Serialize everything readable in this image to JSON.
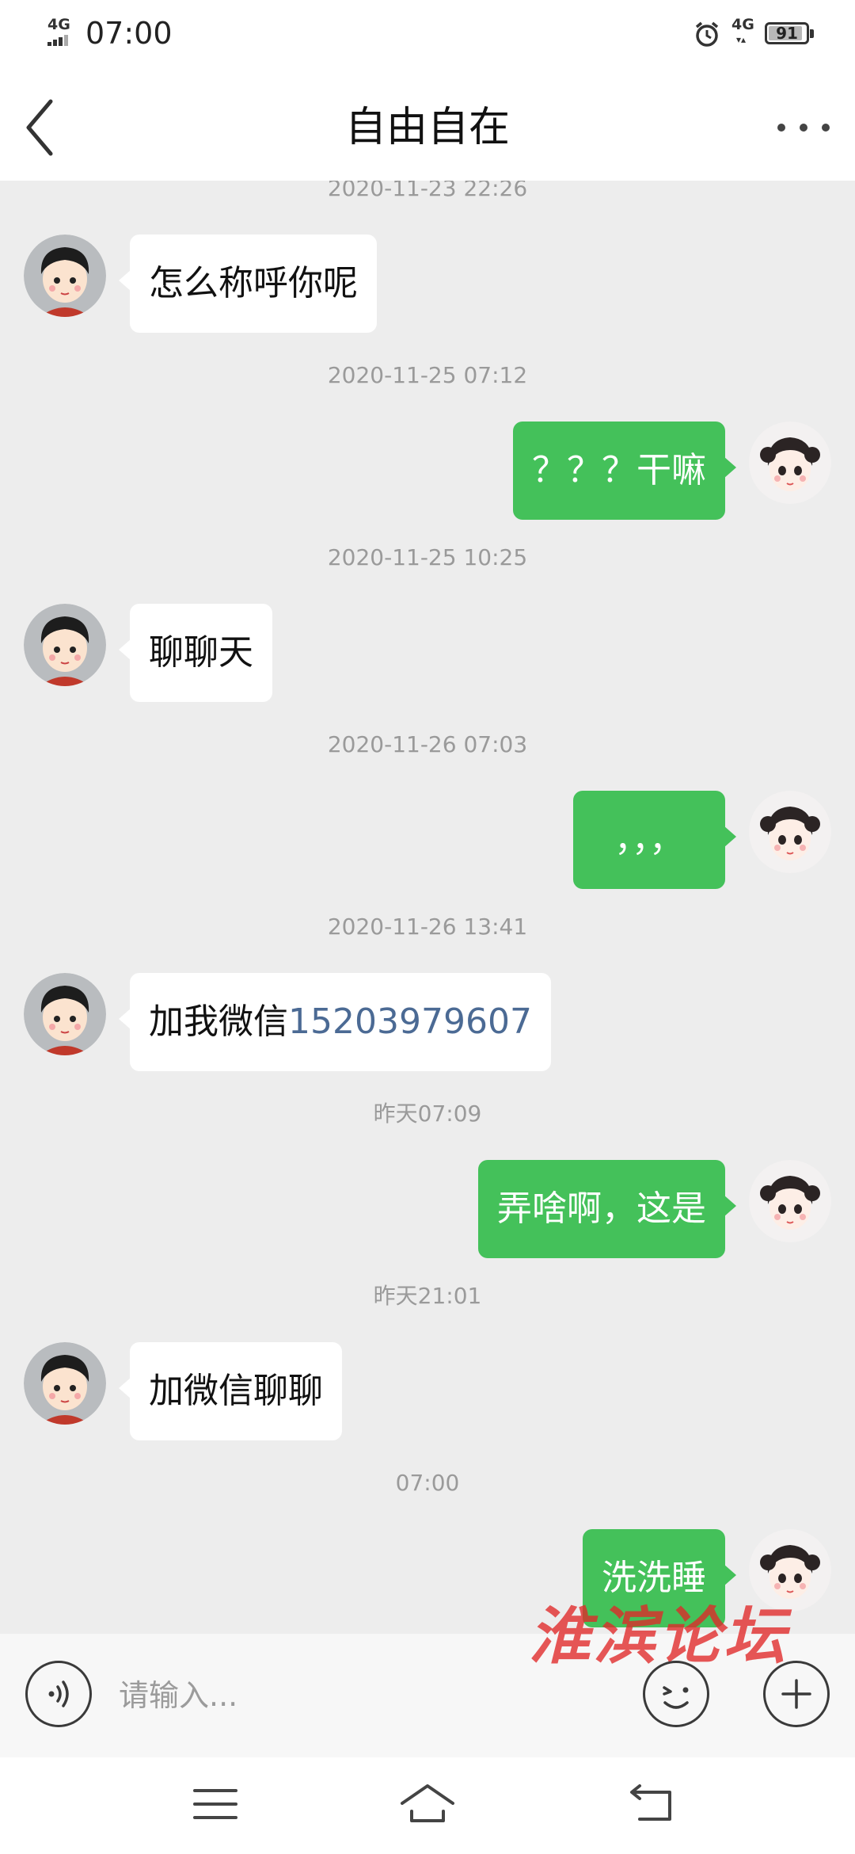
{
  "status_bar": {
    "network_left": "4G",
    "time": "07:00",
    "network_right": "4G",
    "battery_level": "91",
    "battery_fraction": 0.91
  },
  "header": {
    "title": "自由自在"
  },
  "messages": [
    {
      "type": "timestamp",
      "text": "2020-11-23 22:26"
    },
    {
      "type": "message",
      "side": "left",
      "text": "怎么称呼你呢"
    },
    {
      "type": "timestamp",
      "text": "2020-11-25 07:12"
    },
    {
      "type": "message",
      "side": "right",
      "text": "？？？干嘛"
    },
    {
      "type": "timestamp",
      "text": "2020-11-25 10:25"
    },
    {
      "type": "message",
      "side": "left",
      "text": "聊聊天"
    },
    {
      "type": "timestamp",
      "text": "2020-11-26 07:03"
    },
    {
      "type": "message",
      "side": "right",
      "text": "，，，"
    },
    {
      "type": "timestamp",
      "text": "2020-11-26 13:41"
    },
    {
      "type": "message",
      "side": "left",
      "text": "加我微信",
      "link_text": "15203979607"
    },
    {
      "type": "timestamp",
      "text": "昨天07:09"
    },
    {
      "type": "message",
      "side": "right",
      "text": "弄啥啊，这是"
    },
    {
      "type": "timestamp",
      "text": "昨天21:01"
    },
    {
      "type": "message",
      "side": "left",
      "text": "加微信聊聊"
    },
    {
      "type": "timestamp",
      "text": "07:00"
    },
    {
      "type": "message",
      "side": "right",
      "text": "洗洗睡"
    }
  ],
  "input_bar": {
    "placeholder": "请输入..."
  },
  "watermark": "淮滨论坛",
  "icons": {
    "back": "chevron-left-icon",
    "more": "more-dots-icon",
    "voice": "voice-icon",
    "emoji": "emoji-icon",
    "plus": "plus-icon",
    "nav_menu": "menu-icon",
    "nav_home": "home-icon",
    "nav_back": "back-arrow-icon",
    "alarm": "alarm-icon"
  },
  "colors": {
    "sent_bubble": "#44c15a",
    "received_bubble": "#ffffff",
    "chat_background": "#ededed",
    "phone_link": "#4b6a94",
    "watermark": "#e02828"
  }
}
